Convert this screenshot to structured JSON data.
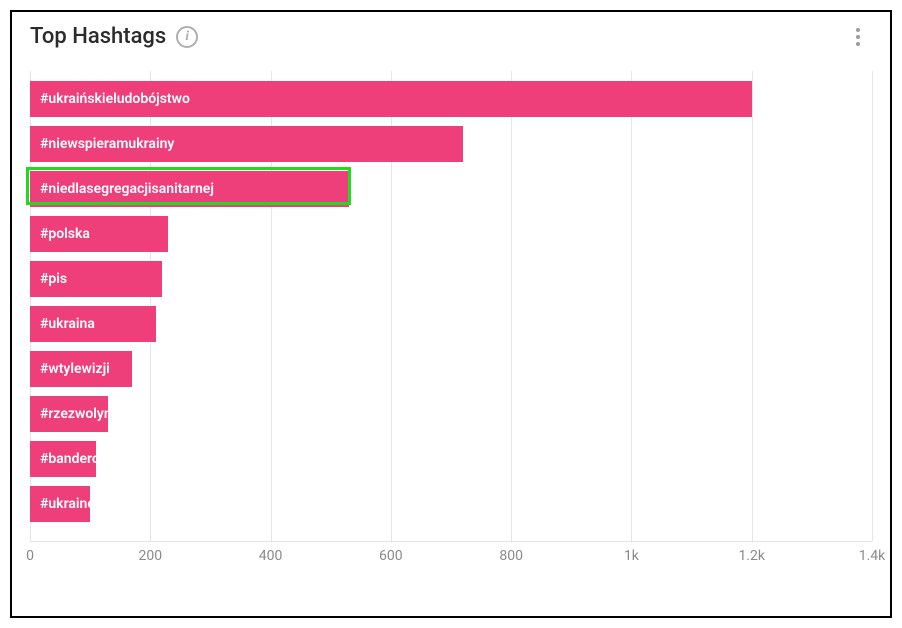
{
  "header": {
    "title": "Top Hashtags"
  },
  "chart_data": {
    "type": "bar",
    "orientation": "horizontal",
    "title": "Top Hashtags",
    "xlabel": "",
    "ylabel": "",
    "xlim": [
      0,
      1400
    ],
    "x_ticks": [
      {
        "value": 0,
        "label": "0"
      },
      {
        "value": 200,
        "label": "200"
      },
      {
        "value": 400,
        "label": "400"
      },
      {
        "value": 600,
        "label": "600"
      },
      {
        "value": 800,
        "label": "800"
      },
      {
        "value": 1000,
        "label": "1k"
      },
      {
        "value": 1200,
        "label": "1.2k"
      },
      {
        "value": 1400,
        "label": "1.4k"
      }
    ],
    "bar_color": "#ef3f7b",
    "highlight_index": 2,
    "categories": [
      "#ukraińskieludobójstwo",
      "#niewspieramukrainy",
      "#niedlasegregacjisanitarnej",
      "#polska",
      "#pis",
      "#ukraina",
      "#wtylewizji",
      "#rzezwolynska",
      "#banderowcy",
      "#ukraine"
    ],
    "values": [
      1200,
      720,
      530,
      230,
      220,
      210,
      170,
      130,
      110,
      100
    ]
  }
}
